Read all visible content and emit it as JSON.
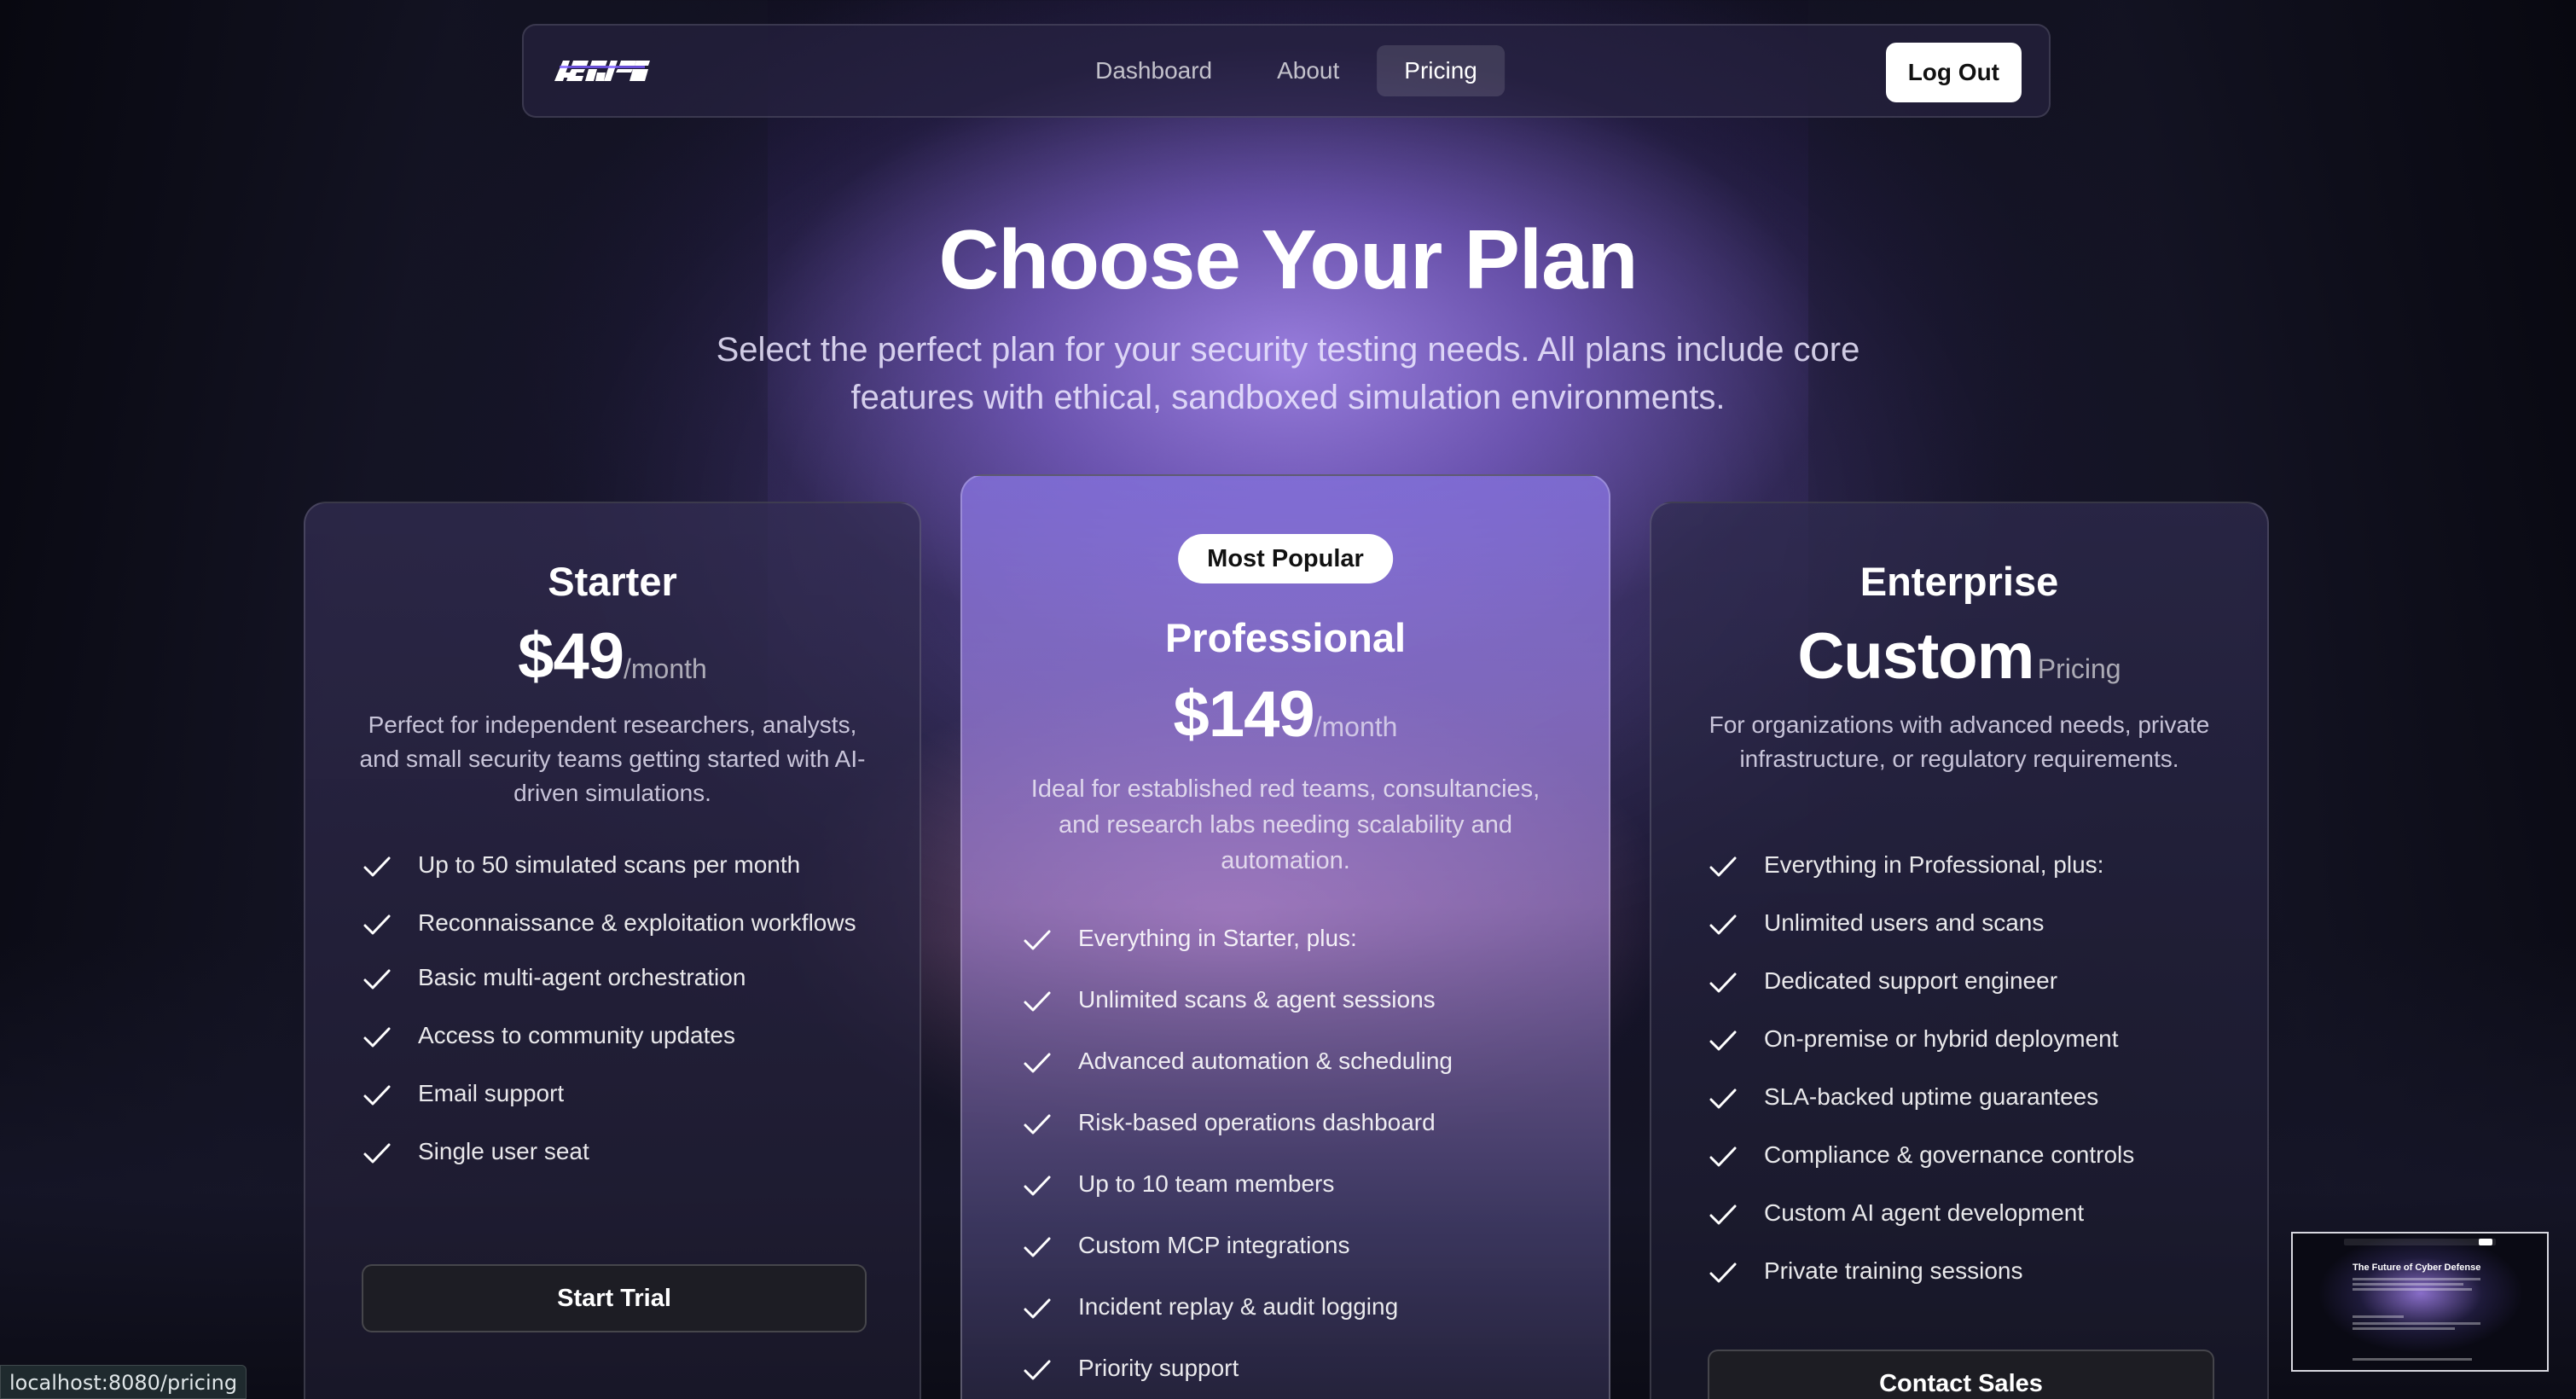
{
  "nav": {
    "logo_text": "AEGIS",
    "links": [
      {
        "label": "Dashboard",
        "active": false
      },
      {
        "label": "About",
        "active": false
      },
      {
        "label": "Pricing",
        "active": true
      }
    ],
    "logout_label": "Log Out"
  },
  "hero": {
    "title": "Choose Your Plan",
    "subtitle": "Select the perfect plan for your security testing needs. All plans include core features with ethical, sandboxed simulation environments."
  },
  "plans": [
    {
      "name": "Starter",
      "price": "$49",
      "period": "/month",
      "description": "Perfect for independent researchers, analysts, and small security teams getting started with AI-driven simulations.",
      "features": [
        "Up to 50 simulated scans per month",
        "Reconnaissance & exploitation workflows",
        "Basic multi-agent orchestration",
        "Access to community updates",
        "Email support",
        "Single user seat"
      ],
      "cta": "Start Trial"
    },
    {
      "badge": "Most Popular",
      "name": "Professional",
      "price": "$149",
      "period": "/month",
      "description": "Ideal for established red teams, consultancies, and research labs needing scalability and automation.",
      "features": [
        "Everything in Starter, plus:",
        "Unlimited scans & agent sessions",
        "Advanced automation & scheduling",
        "Risk-based operations dashboard",
        "Up to 10 team members",
        "Custom MCP integrations",
        "Incident replay & audit logging",
        "Priority support"
      ]
    },
    {
      "name": "Enterprise",
      "price": "Custom",
      "period": "Pricing",
      "description": "For organizations with advanced needs, private infrastructure, or regulatory requirements.",
      "features": [
        "Everything in Professional, plus:",
        "Unlimited users and scans",
        "Dedicated support engineer",
        "On-premise or hybrid deployment",
        "SLA-backed uptime guarantees",
        "Compliance & governance controls",
        "Custom AI agent development",
        "Private training sessions"
      ],
      "cta": "Contact Sales"
    }
  ],
  "statusbar": {
    "url": "localhost:8080/pricing"
  },
  "thumbnail": {
    "title": "The Future of Cyber Defense"
  },
  "colors": {
    "accent": "#9c80e2",
    "button_bg": "#ffffff"
  },
  "icons": {
    "check": "check-icon"
  }
}
